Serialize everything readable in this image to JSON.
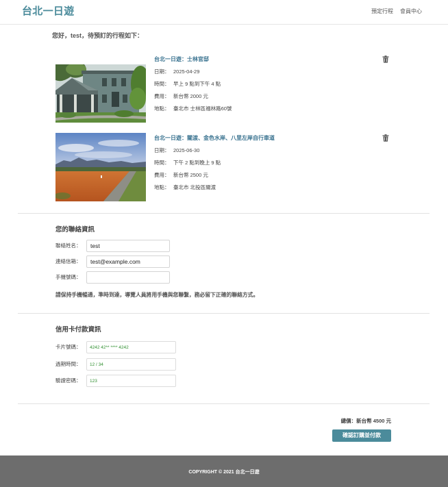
{
  "header": {
    "logo": "台北一日遊",
    "nav": [
      {
        "label": "預定行程"
      },
      {
        "label": "會員中心"
      }
    ]
  },
  "greeting": "您好，test，待預訂的行程如下：",
  "bookings": [
    {
      "title": "台北一日遊：士林官邸",
      "fields": [
        {
          "label": "日期：",
          "value": "2025-04-29"
        },
        {
          "label": "時間：",
          "value": "早上 9 點到下午 4 點"
        },
        {
          "label": "費用：",
          "value": "新台幣 2000 元"
        },
        {
          "label": "地點：",
          "value": "臺北市 士林區福林路60號"
        }
      ],
      "delete_icon": "trash-icon"
    },
    {
      "title": "台北一日遊：關渡、金色水岸、八里左岸自行車道",
      "fields": [
        {
          "label": "日期：",
          "value": "2025-06-30"
        },
        {
          "label": "時間：",
          "value": "下午 2 點到晚上 9 點"
        },
        {
          "label": "費用：",
          "value": "新台幣 2500 元"
        },
        {
          "label": "地點：",
          "value": "臺北市 北投區關渡"
        }
      ],
      "delete_icon": "trash-icon"
    }
  ],
  "contact": {
    "heading": "您的聯絡資訊",
    "fields": [
      {
        "label": "聯絡姓名：",
        "value": "test"
      },
      {
        "label": "連絡信箱：",
        "value": "test@example.com"
      },
      {
        "label": "手機號碼："
      }
    ],
    "note": "請保持手機暢通，準時到達，導覽人員將用手機與您聯繫，務必留下正確的聯絡方式。"
  },
  "payment": {
    "heading": "信用卡付款資訊",
    "fields": [
      {
        "label": "卡片號碼：",
        "value": "4242 42** **** 4242"
      },
      {
        "label": "過期時間：",
        "value": "12 / 34"
      },
      {
        "label": "驗證密碼：",
        "value": "123"
      }
    ]
  },
  "summary": {
    "total": "總價：新台幣 4500 元",
    "confirm_button": "確認訂購並付款"
  },
  "footer": {
    "copyright": "COPYRIGHT © 2021 台北一日遊"
  },
  "colors": {
    "brand": "#4b8b9b",
    "trip_title": "#3a7390",
    "card_text": "#2f8f2f",
    "footer_bg": "#6d6d6d"
  }
}
